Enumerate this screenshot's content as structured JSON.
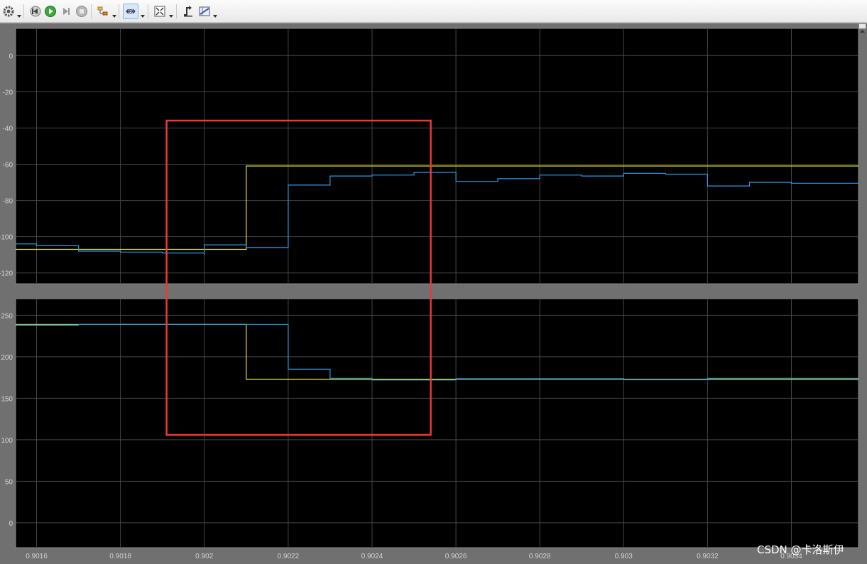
{
  "toolbar": {
    "buttons": [
      {
        "icon": "gear-icon",
        "has_dropdown": true
      },
      {
        "icon": "step-back-icon",
        "has_dropdown": false
      },
      {
        "icon": "run-icon",
        "has_dropdown": false
      },
      {
        "icon": "step-forward-icon",
        "has_dropdown": false
      },
      {
        "icon": "stop-icon",
        "has_dropdown": false
      },
      {
        "icon": "highlight-block-icon",
        "has_dropdown": true
      },
      {
        "icon": "zoom-x-icon",
        "has_dropdown": true,
        "active": true
      },
      {
        "icon": "autoscale-icon",
        "has_dropdown": true
      },
      {
        "icon": "triggers-icon",
        "has_dropdown": false
      },
      {
        "icon": "cursor-measurements-icon",
        "has_dropdown": true
      }
    ]
  },
  "colors": {
    "background": "#000000",
    "grid": "#444444",
    "tick_text": "#d2d2d2",
    "series1": "#e6e62e",
    "series2": "#2e9be8",
    "annotation_box": "#e83a3a"
  },
  "chart_data": [
    {
      "type": "line",
      "step": true,
      "xlim": [
        0.90155,
        0.90356
      ],
      "ylim": [
        -126,
        15
      ],
      "x_ticks": [
        0.9016,
        0.9018,
        0.902,
        0.9022,
        0.9024,
        0.9026,
        0.9028,
        0.903,
        0.9032,
        0.9034
      ],
      "x_tick_labels": [
        "0.9016",
        "0.9018",
        "0.902",
        "0.9022",
        "0.9024",
        "0.9026",
        "0.9028",
        "0.903",
        "0.9032",
        "0.9034"
      ],
      "y_ticks": [
        0,
        -20,
        -40,
        -60,
        -80,
        -100,
        -120
      ],
      "y_tick_labels": [
        "0",
        "-20",
        "-40",
        "-60",
        "-80",
        "-100",
        "-120"
      ],
      "grid": true,
      "series": [
        {
          "color": "#e6e62e",
          "points": [
            [
              0.90155,
              -107
            ],
            [
              0.9021,
              -107
            ],
            [
              0.9021,
              -61
            ],
            [
              0.90356,
              -61
            ]
          ]
        },
        {
          "color": "#2e9be8",
          "points": [
            [
              0.90155,
              -104
            ],
            [
              0.9016,
              -104
            ],
            [
              0.9016,
              -105
            ],
            [
              0.9017,
              -105
            ],
            [
              0.9017,
              -108
            ],
            [
              0.9018,
              -108
            ],
            [
              0.9018,
              -108.5
            ],
            [
              0.9019,
              -108.5
            ],
            [
              0.9019,
              -109
            ],
            [
              0.902,
              -109
            ],
            [
              0.902,
              -110
            ],
            [
              0.902,
              -110
            ],
            [
              0.902,
              -104.5
            ],
            [
              0.9021,
              -104.5
            ],
            [
              0.9021,
              -106
            ],
            [
              0.9022,
              -106
            ],
            [
              0.9022,
              -71.5
            ],
            [
              0.9023,
              -71.5
            ],
            [
              0.9023,
              -66.5
            ],
            [
              0.9024,
              -66.5
            ],
            [
              0.9024,
              -66
            ],
            [
              0.9025,
              -66
            ],
            [
              0.9025,
              -64.5
            ],
            [
              0.9026,
              -64.5
            ],
            [
              0.9026,
              -69.5
            ],
            [
              0.9027,
              -69.5
            ],
            [
              0.9027,
              -68
            ],
            [
              0.9028,
              -68
            ],
            [
              0.9028,
              -66
            ],
            [
              0.9029,
              -66
            ],
            [
              0.9029,
              -66.5
            ],
            [
              0.903,
              -66.5
            ],
            [
              0.903,
              -65
            ],
            [
              0.9031,
              -65
            ],
            [
              0.9031,
              -65.5
            ],
            [
              0.9032,
              -65.5
            ],
            [
              0.9032,
              -72
            ],
            [
              0.9033,
              -72
            ],
            [
              0.9033,
              -70
            ],
            [
              0.9034,
              -70
            ],
            [
              0.9034,
              -70.5
            ],
            [
              0.90356,
              -70.5
            ]
          ]
        }
      ]
    },
    {
      "type": "line",
      "step": true,
      "xlim": [
        0.90155,
        0.90356
      ],
      "ylim": [
        -30,
        270
      ],
      "x_ticks": [
        0.9016,
        0.9018,
        0.902,
        0.9022,
        0.9024,
        0.9026,
        0.9028,
        0.903,
        0.9032,
        0.9034
      ],
      "x_tick_labels": [
        "0.9016",
        "0.9018",
        "0.902",
        "0.9022",
        "0.9024",
        "0.9026",
        "0.9028",
        "0.903",
        "0.9032",
        "0.9034"
      ],
      "y_ticks": [
        250,
        200,
        150,
        100,
        50,
        0
      ],
      "y_tick_labels": [
        "250",
        "200",
        "150",
        "100",
        "50",
        "0"
      ],
      "grid": true,
      "series": [
        {
          "color": "#e6e62e",
          "points": [
            [
              0.90155,
              239
            ],
            [
              0.9021,
              239
            ],
            [
              0.9021,
              173
            ],
            [
              0.90356,
              173
            ]
          ]
        },
        {
          "color": "#2e9be8",
          "points": [
            [
              0.90155,
              238
            ],
            [
              0.9017,
              238
            ],
            [
              0.9017,
              239
            ],
            [
              0.9022,
              239
            ],
            [
              0.9022,
              185
            ],
            [
              0.9023,
              185
            ],
            [
              0.9023,
              174
            ],
            [
              0.9024,
              174
            ],
            [
              0.9024,
              172
            ],
            [
              0.9026,
              172
            ],
            [
              0.9026,
              173.5
            ],
            [
              0.903,
              173.5
            ],
            [
              0.903,
              172.5
            ],
            [
              0.9032,
              172.5
            ],
            [
              0.9032,
              174
            ],
            [
              0.90356,
              174
            ]
          ]
        }
      ]
    }
  ],
  "watermark": "CSDN @卡洛斯伊"
}
